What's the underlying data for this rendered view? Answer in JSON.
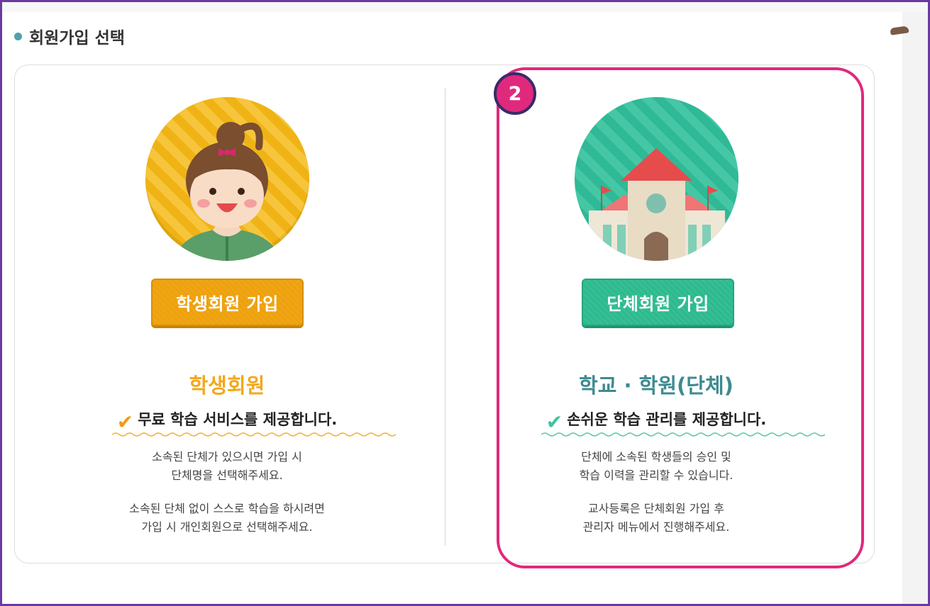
{
  "section": {
    "title": "회원가입 선택"
  },
  "student": {
    "button_label": "학생회원 가입",
    "type_title": "학생회원",
    "feature": "무료 학습 서비스를 제공합니다.",
    "desc1_line1": "소속된 단체가 있으시면 가입 시",
    "desc1_line2": "단체명을 선택해주세요.",
    "desc2_line1": "소속된 단체 없이 스스로 학습을 하시려면",
    "desc2_line2": "가입 시 개인회원으로 선택해주세요."
  },
  "group": {
    "button_label": "단체회원 가입",
    "type_title": "학교 · 학원(단체)",
    "feature": "손쉬운 학습 관리를 제공합니다.",
    "desc1_line1": "단체에 소속된 학생들의 승인 및",
    "desc1_line2": "학습 이력을 관리할 수 있습니다.",
    "desc2_line1": "교사등록은 단체회원 가입 후",
    "desc2_line2": "관리자 메뉴에서 진행해주세요."
  },
  "annotation": {
    "step_number": "2"
  },
  "colors": {
    "student_accent": "#f3a81b",
    "group_accent": "#3d8b8f",
    "highlight": "#e0297c",
    "frame": "#6a3aa3"
  }
}
